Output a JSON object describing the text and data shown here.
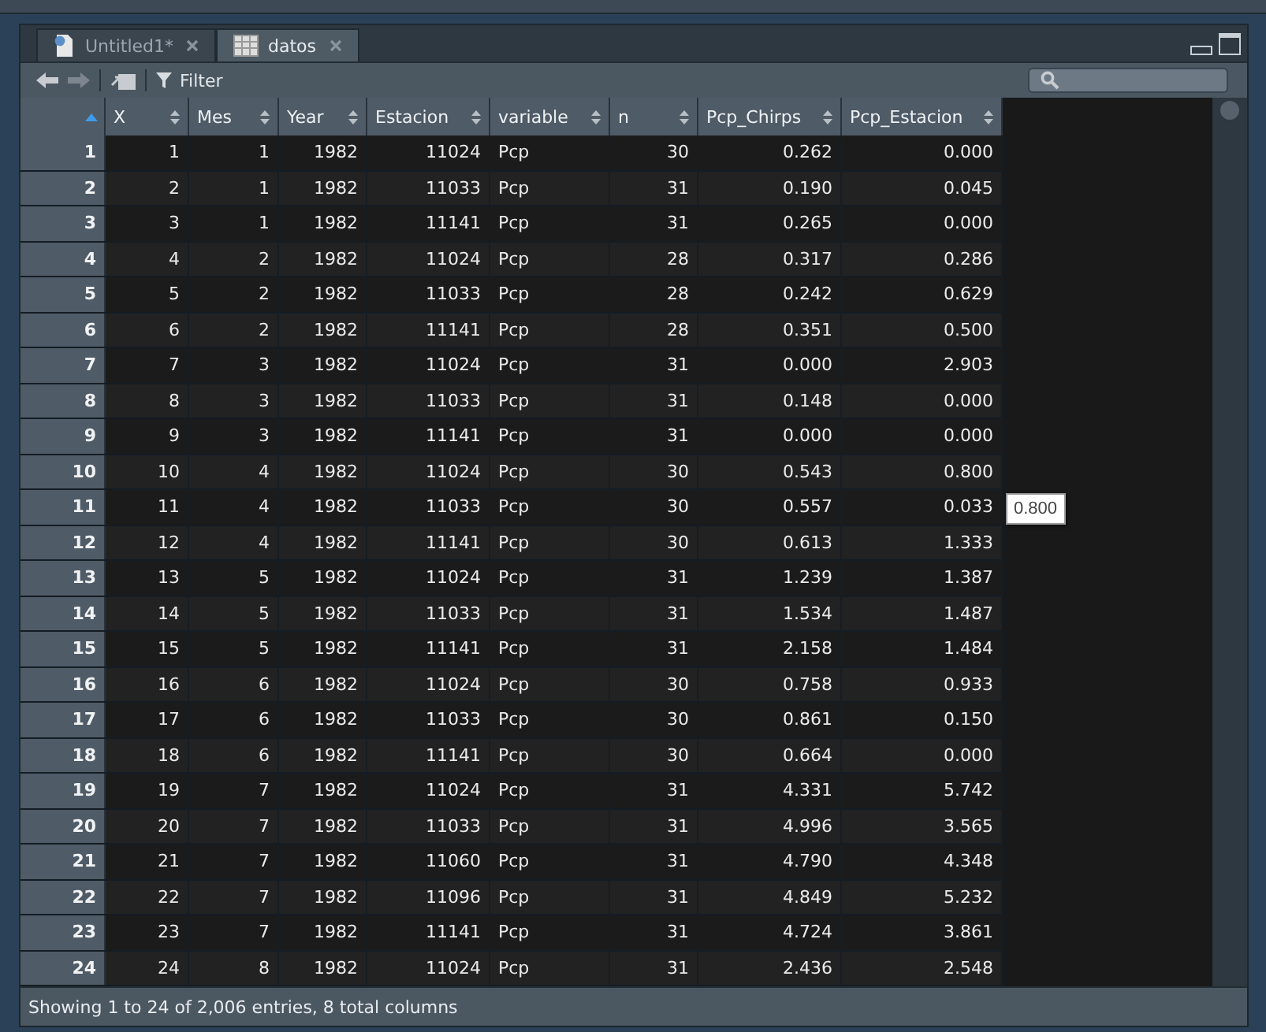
{
  "tabs": [
    {
      "label": "Untitled1*",
      "kind": "script",
      "selected": false
    },
    {
      "label": "datos",
      "kind": "table",
      "selected": true
    }
  ],
  "toolbar": {
    "filter_label": "Filter"
  },
  "table": {
    "columns": [
      "",
      "X",
      "Mes",
      "Year",
      "Estacion",
      "variable",
      "n",
      "Pcp_Chirps",
      "Pcp_Estacion"
    ],
    "rows": [
      [
        "1",
        "1",
        "1",
        "1982",
        "11024",
        "Pcp",
        "30",
        "0.262",
        "0.000"
      ],
      [
        "2",
        "2",
        "1",
        "1982",
        "11033",
        "Pcp",
        "31",
        "0.190",
        "0.045"
      ],
      [
        "3",
        "3",
        "1",
        "1982",
        "11141",
        "Pcp",
        "31",
        "0.265",
        "0.000"
      ],
      [
        "4",
        "4",
        "2",
        "1982",
        "11024",
        "Pcp",
        "28",
        "0.317",
        "0.286"
      ],
      [
        "5",
        "5",
        "2",
        "1982",
        "11033",
        "Pcp",
        "28",
        "0.242",
        "0.629"
      ],
      [
        "6",
        "6",
        "2",
        "1982",
        "11141",
        "Pcp",
        "28",
        "0.351",
        "0.500"
      ],
      [
        "7",
        "7",
        "3",
        "1982",
        "11024",
        "Pcp",
        "31",
        "0.000",
        "2.903"
      ],
      [
        "8",
        "8",
        "3",
        "1982",
        "11033",
        "Pcp",
        "31",
        "0.148",
        "0.000"
      ],
      [
        "9",
        "9",
        "3",
        "1982",
        "11141",
        "Pcp",
        "31",
        "0.000",
        "0.000"
      ],
      [
        "10",
        "10",
        "4",
        "1982",
        "11024",
        "Pcp",
        "30",
        "0.543",
        "0.800"
      ],
      [
        "11",
        "11",
        "4",
        "1982",
        "11033",
        "Pcp",
        "30",
        "0.557",
        "0.033"
      ],
      [
        "12",
        "12",
        "4",
        "1982",
        "11141",
        "Pcp",
        "30",
        "0.613",
        "1.333"
      ],
      [
        "13",
        "13",
        "5",
        "1982",
        "11024",
        "Pcp",
        "31",
        "1.239",
        "1.387"
      ],
      [
        "14",
        "14",
        "5",
        "1982",
        "11033",
        "Pcp",
        "31",
        "1.534",
        "1.487"
      ],
      [
        "15",
        "15",
        "5",
        "1982",
        "11141",
        "Pcp",
        "31",
        "2.158",
        "1.484"
      ],
      [
        "16",
        "16",
        "6",
        "1982",
        "11024",
        "Pcp",
        "30",
        "0.758",
        "0.933"
      ],
      [
        "17",
        "17",
        "6",
        "1982",
        "11033",
        "Pcp",
        "30",
        "0.861",
        "0.150"
      ],
      [
        "18",
        "18",
        "6",
        "1982",
        "11141",
        "Pcp",
        "30",
        "0.664",
        "0.000"
      ],
      [
        "19",
        "19",
        "7",
        "1982",
        "11024",
        "Pcp",
        "31",
        "4.331",
        "5.742"
      ],
      [
        "20",
        "20",
        "7",
        "1982",
        "11033",
        "Pcp",
        "31",
        "4.996",
        "3.565"
      ],
      [
        "21",
        "21",
        "7",
        "1982",
        "11060",
        "Pcp",
        "31",
        "4.790",
        "4.348"
      ],
      [
        "22",
        "22",
        "7",
        "1982",
        "11096",
        "Pcp",
        "31",
        "4.849",
        "5.232"
      ],
      [
        "23",
        "23",
        "7",
        "1982",
        "11141",
        "Pcp",
        "31",
        "4.724",
        "3.861"
      ],
      [
        "24",
        "24",
        "8",
        "1982",
        "11024",
        "Pcp",
        "31",
        "2.436",
        "2.548"
      ]
    ]
  },
  "tooltip": "0.800",
  "status_bar": "Showing 1 to 24 of 2,006 entries, 8 total columns"
}
